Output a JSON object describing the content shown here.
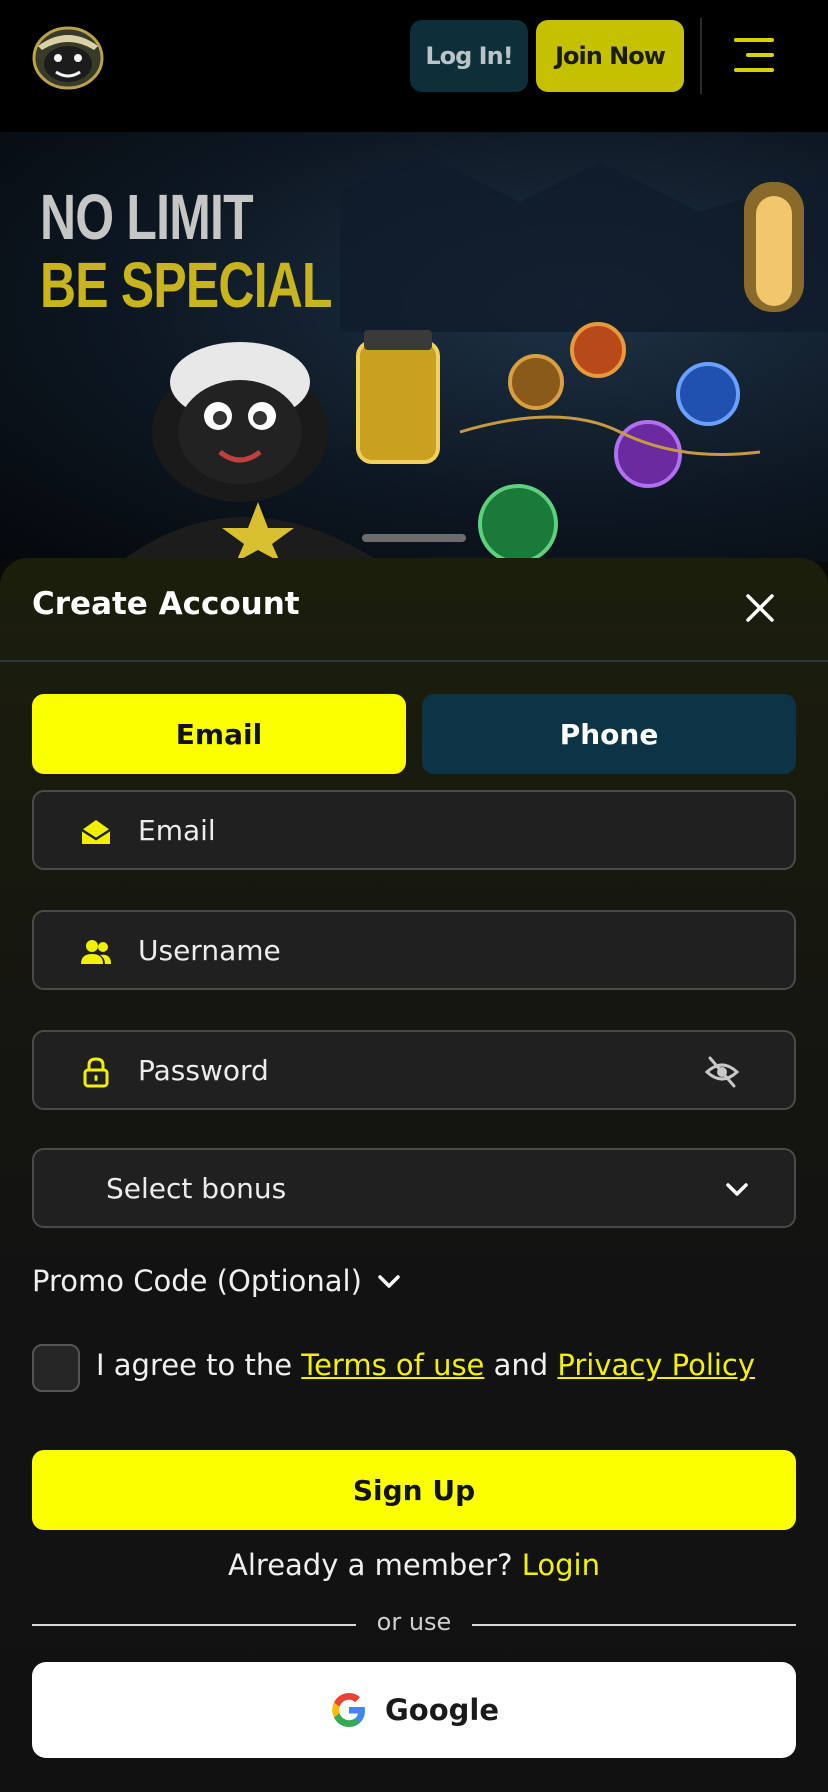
{
  "header": {
    "login_label": "Log In!",
    "join_label": "Join Now"
  },
  "banner": {
    "line1": "NO LIMIT",
    "line2": "BE SPECIAL"
  },
  "modal": {
    "title": "Create Account",
    "tabs": [
      {
        "label": "Email",
        "active": true
      },
      {
        "label": "Phone",
        "active": false
      }
    ],
    "fields": {
      "email": {
        "placeholder": "Email",
        "icon": "envelope-open-icon"
      },
      "username": {
        "placeholder": "Username",
        "icon": "users-icon"
      },
      "password": {
        "placeholder": "Password",
        "icon": "lock-icon",
        "toggle_icon": "eye-slash-icon"
      },
      "bonus": {
        "value": "Select bonus",
        "icon": "chevron-down-icon"
      }
    },
    "promo_label": "Promo Code (Optional)",
    "agree": {
      "prefix": "I agree to the",
      "terms": "Terms of use",
      "and": "and",
      "privacy": "Privacy Policy"
    },
    "signup_label": "Sign Up",
    "member": {
      "text": "Already a member?",
      "login": "Login"
    },
    "or_use": "or use",
    "google_label": "Google"
  },
  "colors": {
    "accent": "#fbff00",
    "join_button": "#c4c200",
    "login_button": "#0e2e3a",
    "phone_tab": "#0d3446"
  }
}
